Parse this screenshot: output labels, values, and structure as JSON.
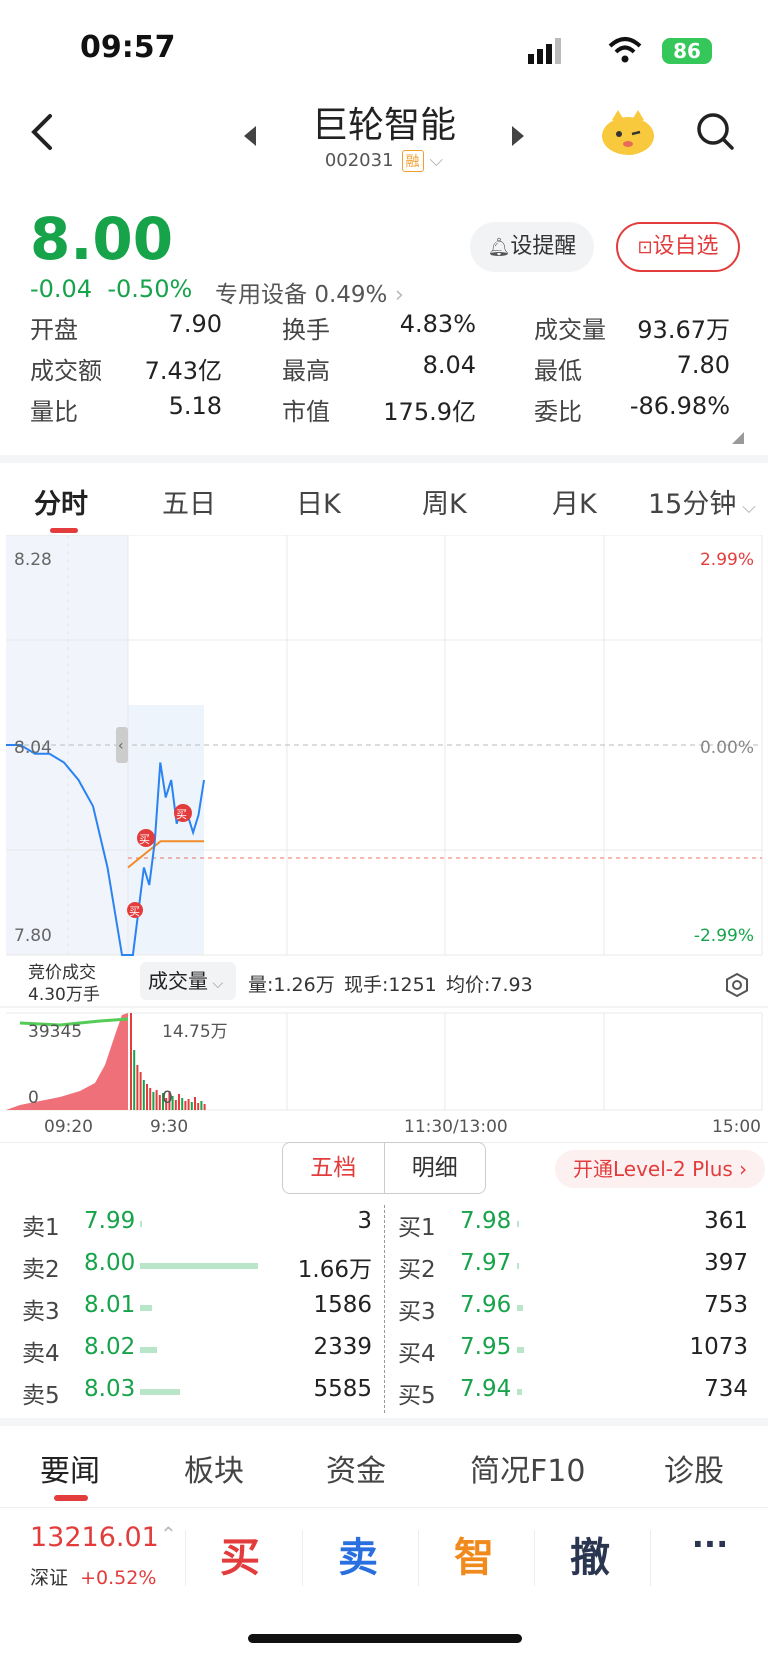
{
  "status_bar": {
    "time": "09:57",
    "battery": "86"
  },
  "header": {
    "title": "巨轮智能",
    "code": "002031",
    "margin_badge": "融"
  },
  "quote": {
    "price": "8.00",
    "change": "-0.04",
    "change_pct": "-0.50%",
    "sector_name": "专用设备",
    "sector_pct": "0.49%"
  },
  "buttons": {
    "alert": "设提醒",
    "favorite": "设自选"
  },
  "stats": [
    {
      "label": "开盘",
      "value": "7.90",
      "color": "green"
    },
    {
      "label": "换手",
      "value": "4.83%",
      "color": "default"
    },
    {
      "label": "成交量",
      "value": "93.67万",
      "color": "default"
    },
    {
      "label": "成交额",
      "value": "7.43亿",
      "color": "default"
    },
    {
      "label": "最高",
      "value": "8.04",
      "color": "default"
    },
    {
      "label": "最低",
      "value": "7.80",
      "color": "green"
    },
    {
      "label": "量比",
      "value": "5.18",
      "color": "default"
    },
    {
      "label": "市值",
      "value": "175.9亿",
      "color": "default"
    },
    {
      "label": "委比",
      "value": "-86.98%",
      "color": "green"
    }
  ],
  "chart_tabs": [
    "分时",
    "五日",
    "日K",
    "周K",
    "月K",
    "15分钟"
  ],
  "chart": {
    "y_top": "8.28",
    "y_mid": "8.04",
    "y_bottom": "7.80",
    "pct_top": "2.99%",
    "pct_mid": "0.00%",
    "pct_bottom": "-2.99%",
    "auction_label": "竞价成交",
    "auction_value": "4.30万手",
    "volume_selector": "成交量",
    "vol_info": "量:1.26万",
    "now_hand": "现手:1251",
    "avg_price": "均价:7.93",
    "vol_left_max": "39345",
    "vol_left_min": "0",
    "vol_right_max": "14.75万",
    "vol_right_min": "0",
    "x_labels": [
      "09:20",
      "9:30",
      "11:30/13:00",
      "15:00"
    ],
    "buy_marker": "买"
  },
  "chart_data": {
    "type": "line",
    "ylim": [
      7.8,
      8.28
    ],
    "series": [
      {
        "name": "price",
        "values": [
          8.04,
          8.04,
          8.03,
          8.03,
          8.02,
          8.0,
          7.97,
          7.9,
          7.8,
          7.8,
          7.8,
          7.85,
          7.9,
          7.88,
          7.93,
          8.02,
          7.98,
          8.0,
          7.95,
          7.97,
          7.96,
          7.94,
          7.96,
          8.0
        ]
      },
      {
        "name": "avg",
        "values": [
          7.9,
          7.91,
          7.92,
          7.93,
          7.93,
          7.93,
          7.93,
          7.93
        ]
      }
    ]
  },
  "orderbook": {
    "tab_five": "五档",
    "tab_detail": "明细",
    "level2": "开通Level-2 Plus",
    "asks": [
      {
        "label": "卖1",
        "price": "7.99",
        "qty": "3",
        "bar": 0.01
      },
      {
        "label": "卖2",
        "price": "8.00",
        "qty": "1.66万",
        "bar": 1.0
      },
      {
        "label": "卖3",
        "price": "8.01",
        "qty": "1586",
        "bar": 0.1
      },
      {
        "label": "卖4",
        "price": "8.02",
        "qty": "2339",
        "bar": 0.14
      },
      {
        "label": "卖5",
        "price": "8.03",
        "qty": "5585",
        "bar": 0.34
      }
    ],
    "bids": [
      {
        "label": "买1",
        "price": "7.98",
        "qty": "361",
        "bar": 0.02
      },
      {
        "label": "买2",
        "price": "7.97",
        "qty": "397",
        "bar": 0.02
      },
      {
        "label": "买3",
        "price": "7.96",
        "qty": "753",
        "bar": 0.05
      },
      {
        "label": "买4",
        "price": "7.95",
        "qty": "1073",
        "bar": 0.06
      },
      {
        "label": "买5",
        "price": "7.94",
        "qty": "734",
        "bar": 0.04
      }
    ]
  },
  "bottom_tabs": [
    "要闻",
    "板块",
    "资金",
    "简况F10",
    "诊股"
  ],
  "footer": {
    "index_value": "13216.01",
    "index_name": "深证",
    "index_pct": "+0.52%",
    "buy": "买",
    "sell": "卖",
    "smart": "智",
    "cancel": "撤",
    "more": "···"
  },
  "colors": {
    "up": "#e23c3c",
    "down": "#16a34a",
    "line": "#2a83f0",
    "avg": "#f28c28"
  }
}
